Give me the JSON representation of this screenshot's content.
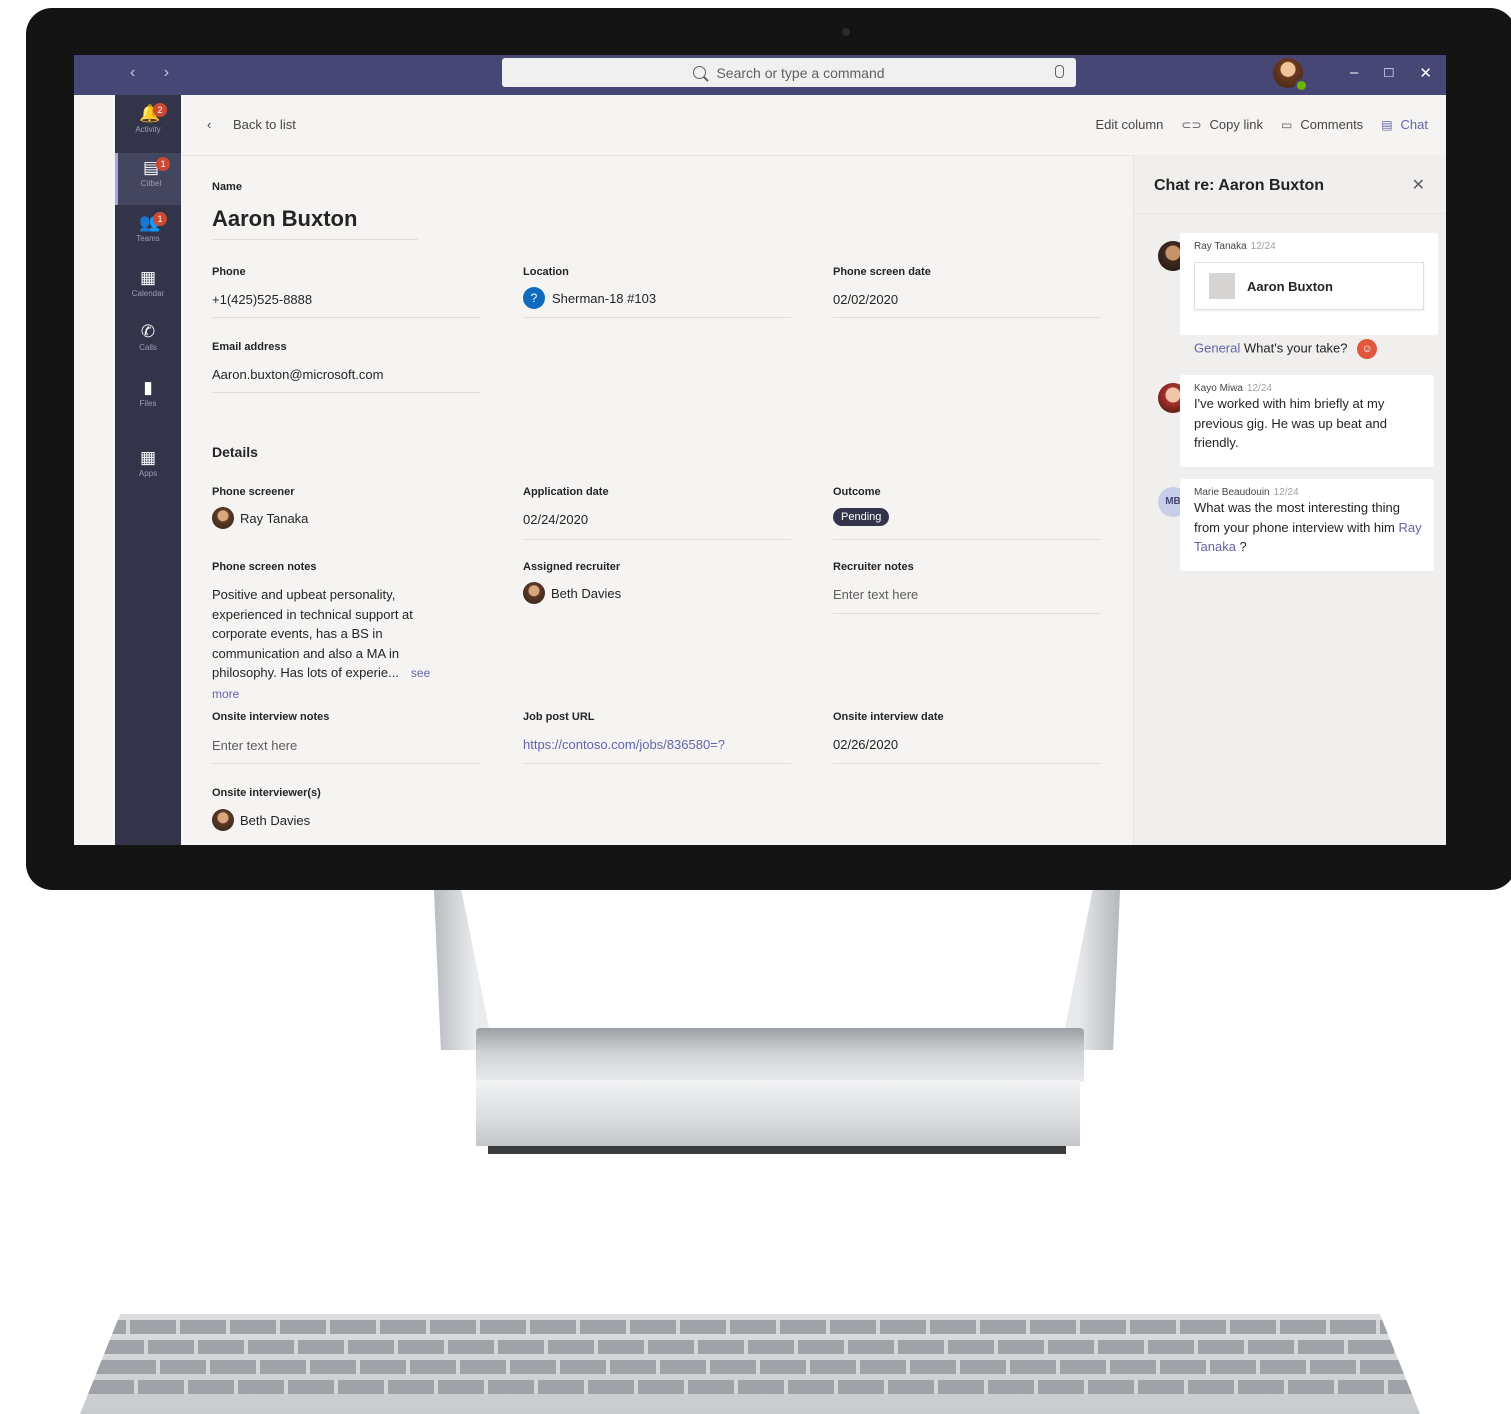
{
  "titlebar": {
    "search_placeholder": "Search or type a command",
    "nav_arrows": "‹ ›",
    "window_buttons": {
      "minimize": "–",
      "maximize": "□",
      "close": "✕"
    }
  },
  "rail": {
    "items": [
      {
        "label": "Activity",
        "icon": "bell-icon",
        "glyph": "🔔",
        "badge": "2"
      },
      {
        "label": "Citbel",
        "icon": "chat-icon",
        "glyph": "▤",
        "badge": "1"
      },
      {
        "label": "Teams",
        "icon": "teams-icon",
        "glyph": "👥",
        "badge": "1"
      },
      {
        "label": "Calendar",
        "icon": "calendar-icon",
        "glyph": "▦",
        "badge": ""
      },
      {
        "label": "Calls",
        "icon": "phone-icon",
        "glyph": "✆",
        "badge": ""
      },
      {
        "label": "Files",
        "icon": "file-icon",
        "glyph": "▮",
        "badge": ""
      },
      {
        "label": "Apps",
        "icon": "apps-icon",
        "glyph": "▦",
        "badge": ""
      }
    ]
  },
  "topbar": {
    "back_label": "Back to list",
    "edit_column": "Edit column",
    "copy_link": "Copy link",
    "comments": "Comments",
    "chat": "Chat"
  },
  "record": {
    "name_label": "Name",
    "name": "Aaron Buxton",
    "phone_label": "Phone",
    "phone": "+1(425)525-8888",
    "location_label": "Location",
    "location": "Sherman-18 #103",
    "phone_screen_date_label": "Phone screen date",
    "phone_screen_date": "02/02/2020",
    "email_label": "Email address",
    "email": "Aaron.buxton@microsoft.com",
    "details_title": "Details",
    "phone_screener_label": "Phone screener",
    "phone_screener": "Ray Tanaka",
    "application_date_label": "Application date",
    "application_date": "02/24/2020",
    "outcome_label": "Outcome",
    "outcome": "Pending",
    "phone_screen_notes_label": "Phone screen notes",
    "phone_screen_notes": "Positive and upbeat personality, experienced in technical support at corporate events, has a BS in communication and also a MA in philosophy. Has lots of experie...",
    "see_more": "see more",
    "assigned_recruiter_label": "Assigned recruiter",
    "assigned_recruiter": "Beth Davies",
    "recruiter_notes_label": "Recruiter notes",
    "recruiter_notes_placeholder": "Enter text here",
    "onsite_notes_label": "Onsite interview notes",
    "onsite_notes_placeholder": "Enter text here",
    "job_post_url_label": "Job post URL",
    "job_post_url": "https://contoso.com/jobs/836580=?",
    "onsite_date_label": "Onsite interview date",
    "onsite_date": "02/26/2020",
    "onsite_interviewers_label": "Onsite interviewer(s)",
    "onsite_interviewer": "Beth Davies"
  },
  "chat": {
    "title": "Chat re: Aaron Buxton",
    "messages": [
      {
        "author": "Ray Tanaka",
        "time": "12/24",
        "card_title": "Aaron Buxton"
      },
      {
        "author": "Kayo Miwa",
        "time": "12/24",
        "body": "I've worked with him briefly at my previous gig. He was up beat and friendly."
      },
      {
        "author": "Marie Beaudouin",
        "initials": "MB",
        "time": "12/24",
        "body": "What was the most interesting thing from your phone interview with him",
        "mention": "Ray Tanaka",
        "suffix": " ?"
      }
    ],
    "channel": "General",
    "channel_text": "What's your take?"
  },
  "colors": {
    "titlebar": "#464775",
    "rail": "#33344a",
    "accent": "#6264a7",
    "pending_badge": "#33344a",
    "presence": "#6bb700"
  }
}
